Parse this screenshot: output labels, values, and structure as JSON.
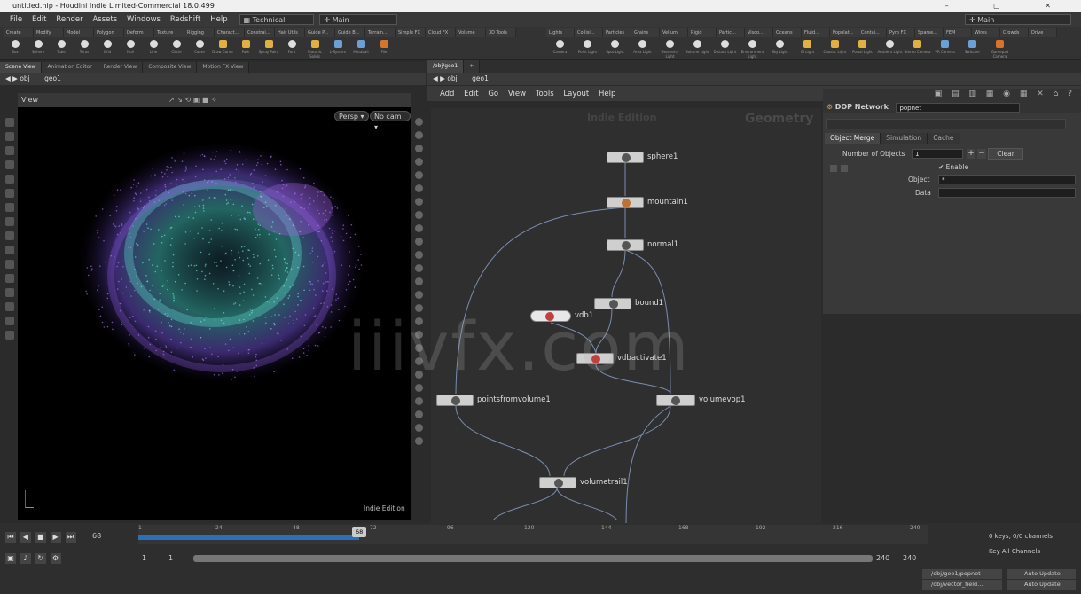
{
  "window": {
    "title": "untitled.hip - Houdini Indie Limited-Commercial 18.0.499"
  },
  "menubar": {
    "items": [
      "File",
      "Edit",
      "Render",
      "Assets",
      "Windows",
      "Redshift",
      "Help"
    ],
    "desktop": "Technical",
    "main_left": "Main",
    "main_right": "Main"
  },
  "shelf": {
    "left_tabs": [
      "Create",
      "Modify",
      "Model",
      "Polygon",
      "Deform",
      "Texture",
      "Rigging",
      "Charact...",
      "Constrai...",
      "Hair Utils",
      "Guide P...",
      "Guide B...",
      "Terrain...",
      "Simple FX",
      "Cloud FX",
      "Volume",
      "3D Tools"
    ],
    "left_tools": [
      "Box",
      "Sphere",
      "Tube",
      "Torus",
      "Grid",
      "Null",
      "Line",
      "Circle",
      "Curve",
      "Draw Curve",
      "Path",
      "Spray Paint",
      "Font",
      "Platonic Solids",
      "L-System",
      "Metaball",
      "File"
    ],
    "right_tabs": [
      "Lights",
      "Collisi...",
      "Particles",
      "Grains",
      "Vellum",
      "Rigid",
      "Partic...",
      "Visco...",
      "Oceans",
      "Fluid...",
      "Populat...",
      "Contai...",
      "Pyro FX",
      "Sparse...",
      "FEM",
      "Wires",
      "Crowds",
      "Drive"
    ],
    "right_tools": [
      "Camera",
      "Point Light",
      "Spot Light",
      "Area Light",
      "Geometry Light",
      "Volume Light",
      "Distant Light",
      "Environment Light",
      "Sky Light",
      "GI Light",
      "Caustic Light",
      "Portal Light",
      "Ambient Light",
      "Stereo Camera",
      "VR Camera",
      "Switcher",
      "Gamepad Camera"
    ]
  },
  "left_pane": {
    "tabs": [
      "Scene View",
      "Animation Editor",
      "Render View",
      "Composite View",
      "Motion FX View"
    ],
    "path": [
      "obj",
      "geo1"
    ],
    "view_label": "View",
    "persp": "Persp",
    "cam": "No cam",
    "edition": "Indie Edition"
  },
  "network_pane": {
    "tab": "/obj/geo1",
    "path": [
      "obj",
      "geo1"
    ],
    "menu": [
      "Add",
      "Edit",
      "Go",
      "View",
      "Tools",
      "Layout",
      "Help"
    ],
    "edition_label": "Indie Edition",
    "context_label": "Geometry",
    "nodes": [
      {
        "id": "sphere1",
        "label": "sphere1"
      },
      {
        "id": "mountain1",
        "label": "mountain1"
      },
      {
        "id": "normal1",
        "label": "normal1"
      },
      {
        "id": "bound1",
        "label": "bound1"
      },
      {
        "id": "vdb1",
        "label": "vdb1"
      },
      {
        "id": "vdbactivate1",
        "label": "vdbactivate1"
      },
      {
        "id": "pointsfromvolume1",
        "label": "pointsfromvolume1"
      },
      {
        "id": "volumevop1",
        "label": "volumevop1"
      },
      {
        "id": "volumetrail1",
        "label": "volumetrail1"
      }
    ]
  },
  "params": {
    "node_type": "DOP Network",
    "node_name": "popnet",
    "tabs": [
      "Object Merge",
      "Simulation",
      "Cache"
    ],
    "number_of_objects_label": "Number of Objects",
    "number_of_objects": "1",
    "clear_label": "Clear",
    "enable_label": "Enable",
    "object_label": "Object",
    "object_value": "*",
    "data_label": "Data"
  },
  "timeline": {
    "current_frame": "68",
    "ticks": [
      "1",
      "24",
      "48",
      "72",
      "96",
      "120",
      "144",
      "168",
      "192",
      "216",
      "240"
    ],
    "start": "1",
    "start2": "1",
    "end": "240",
    "end2": "240",
    "current_fraction": 0.28,
    "keys_label": "0 keys, 0/0 channels",
    "channels_label": "Key All Channels",
    "path1": "/obj/geo1/popnet",
    "path2": "/obj/vector_field...",
    "update1": "Auto Update",
    "update2": "Auto Update"
  },
  "watermark": "iiivfx.com"
}
